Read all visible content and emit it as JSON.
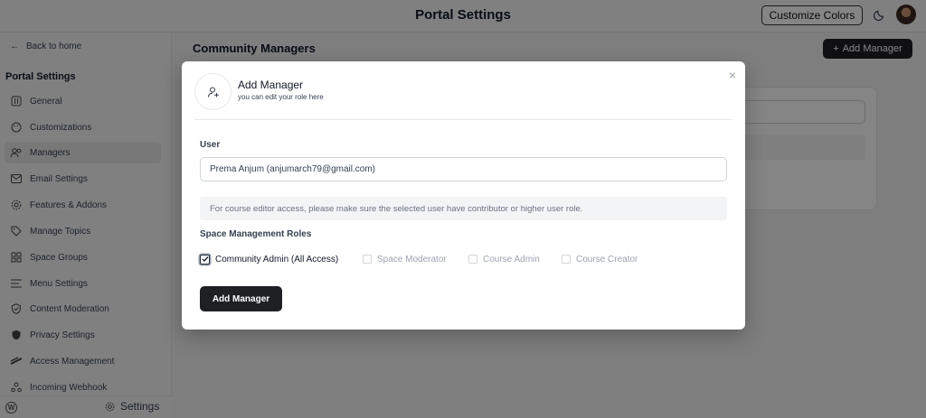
{
  "header": {
    "title": "Portal Settings",
    "customize_label": "Customize Colors",
    "theme_icon": "moon-icon",
    "avatar_icon": "user-avatar"
  },
  "sidebar": {
    "back_label": "Back to home",
    "heading": "Portal Settings",
    "items": [
      {
        "label": "General",
        "icon": "sliders-icon"
      },
      {
        "label": "Customizations",
        "icon": "palette-icon"
      },
      {
        "label": "Managers",
        "icon": "users-icon",
        "active": true
      },
      {
        "label": "Email Settings",
        "icon": "mail-icon"
      },
      {
        "label": "Features & Addons",
        "icon": "cog-icon"
      },
      {
        "label": "Manage Topics",
        "icon": "tag-icon"
      },
      {
        "label": "Space Groups",
        "icon": "grid-icon"
      },
      {
        "label": "Menu Settings",
        "icon": "menu-icon"
      },
      {
        "label": "Content Moderation",
        "icon": "shield-check-icon"
      },
      {
        "label": "Privacy Settings",
        "icon": "shield-icon"
      },
      {
        "label": "Access Management",
        "icon": "key-icon"
      },
      {
        "label": "Incoming Webhook",
        "icon": "webhook-icon"
      }
    ],
    "footer_settings_label": "Settings"
  },
  "main": {
    "title": "Community Managers",
    "add_button_label": "Add Manager"
  },
  "modal": {
    "title": "Add Manager",
    "subtitle": "you can edit your role here",
    "close_glyph": "×",
    "user_label": "User",
    "user_value": "Prema Anjum (anjumarch79@gmail.com)",
    "notice": "For course editor access, please make sure the selected user have contributor or higher user role.",
    "roles_label": "Space Management Roles",
    "roles": [
      {
        "label": "Community Admin (All Access)",
        "checked": true,
        "enabled": true
      },
      {
        "label": "Space Moderator",
        "checked": false,
        "enabled": false
      },
      {
        "label": "Course Admin",
        "checked": false,
        "enabled": false
      },
      {
        "label": "Course Creator",
        "checked": false,
        "enabled": false
      }
    ],
    "submit_label": "Add Manager"
  }
}
